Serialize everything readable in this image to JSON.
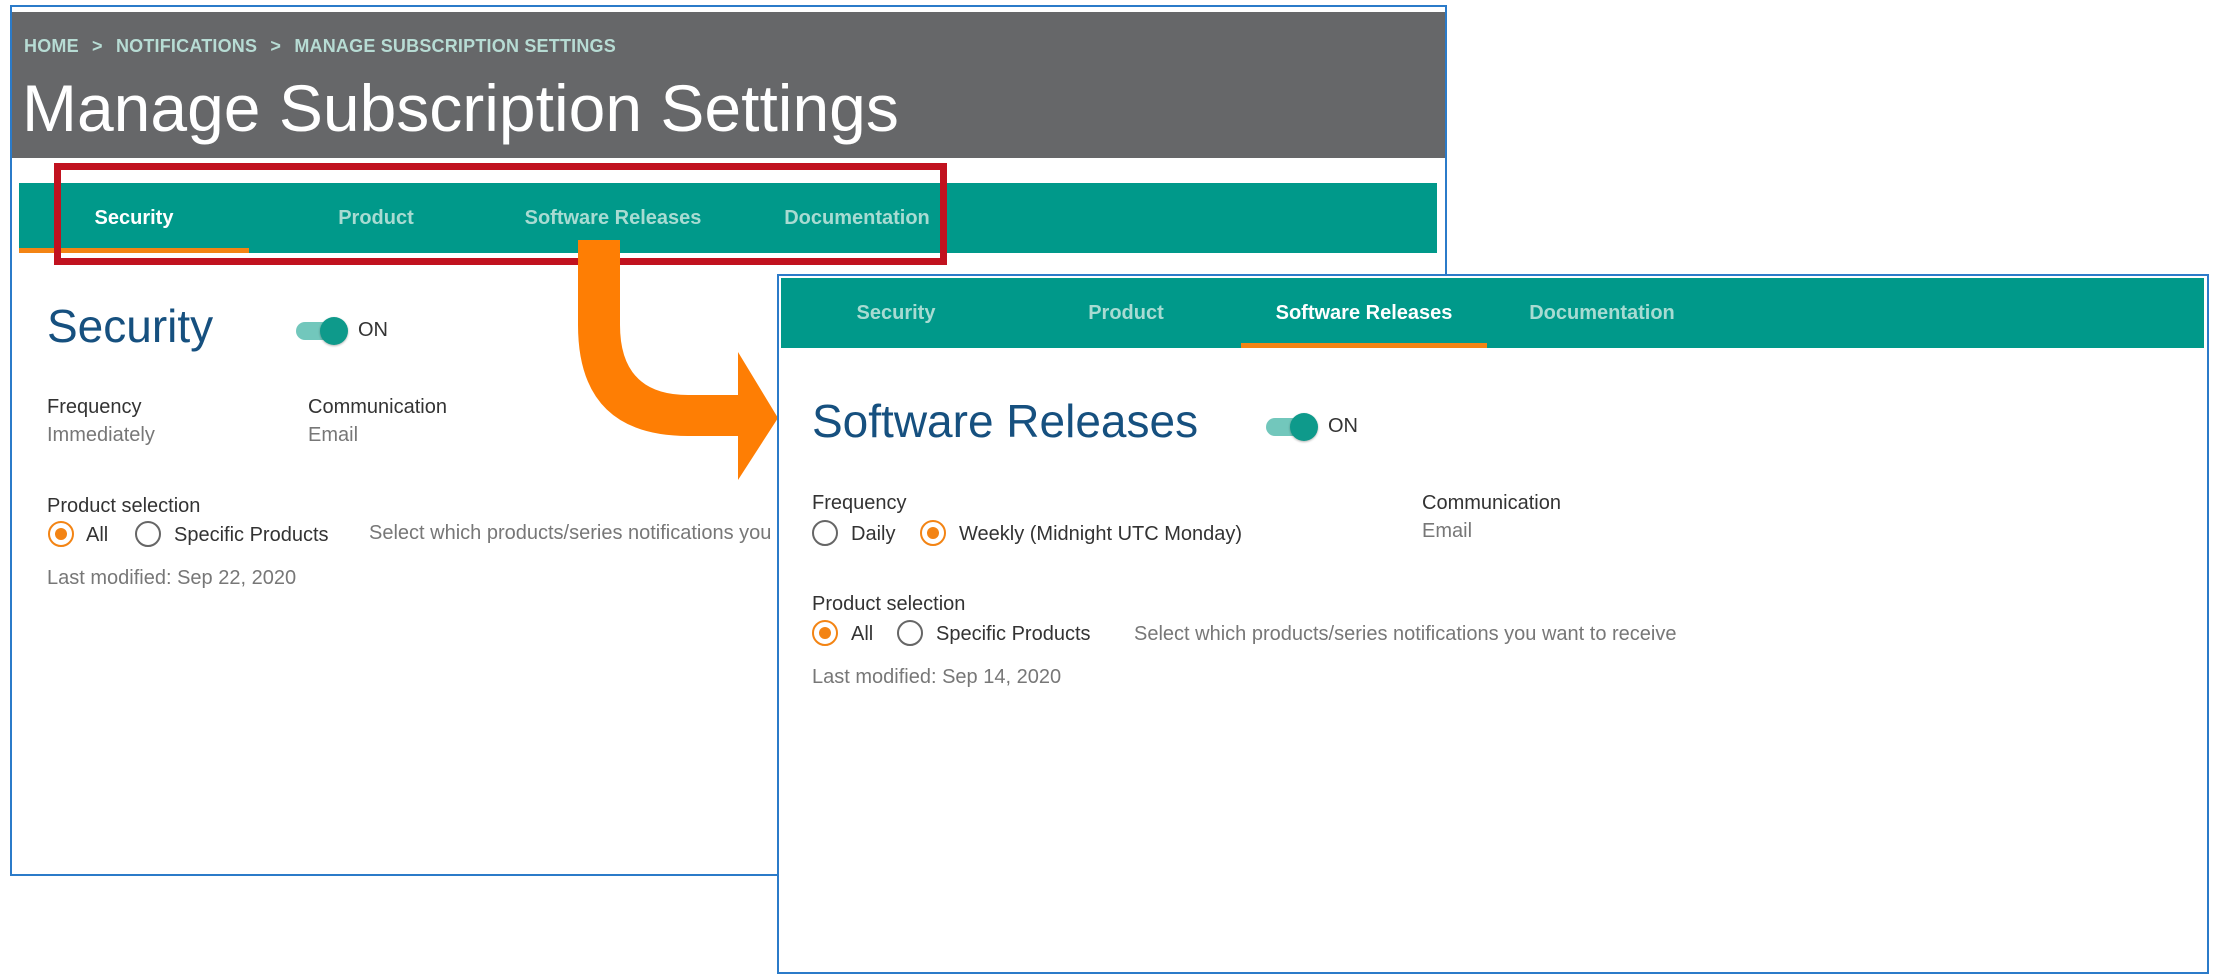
{
  "back_window": {
    "breadcrumb": [
      "HOME",
      ">",
      "NOTIFICATIONS",
      ">",
      "MANAGE SUBSCRIPTION SETTINGS"
    ],
    "page_title": "Manage Subscription Settings",
    "tabs": [
      {
        "label": "Security",
        "active": true
      },
      {
        "label": "Product",
        "active": false
      },
      {
        "label": "Software Releases",
        "active": false
      },
      {
        "label": "Documentation",
        "active": false
      }
    ],
    "section_title": "Security",
    "toggle_label": "ON",
    "frequency_label": "Frequency",
    "frequency_value": "Immediately",
    "communication_label": "Communication",
    "communication_value": "Email",
    "product_selection_label": "Product selection",
    "radio_all": "All",
    "radio_specific": "Specific Products",
    "hint": "Select which products/series notifications you want to receive",
    "last_modified": "Last modified: Sep 22, 2020"
  },
  "front_window": {
    "tabs": [
      {
        "label": "Security",
        "active": false
      },
      {
        "label": "Product",
        "active": false
      },
      {
        "label": "Software Releases",
        "active": true
      },
      {
        "label": "Documentation",
        "active": false
      }
    ],
    "section_title": "Software Releases",
    "toggle_label": "ON",
    "frequency_label": "Frequency",
    "radio_daily": "Daily",
    "radio_weekly": "Weekly (Midnight UTC Monday)",
    "communication_label": "Communication",
    "communication_value": "Email",
    "product_selection_label": "Product selection",
    "radio_all": "All",
    "radio_specific": "Specific Products",
    "hint": "Select which products/series notifications you want to receive",
    "last_modified": "Last modified: Sep 14, 2020"
  },
  "colors": {
    "header_gray": "#666769",
    "tab_teal": "#00998a",
    "accent_orange": "#f38414",
    "highlight_red": "#c1121f",
    "title_blue": "#16507f",
    "window_border": "#2b7bc9"
  }
}
